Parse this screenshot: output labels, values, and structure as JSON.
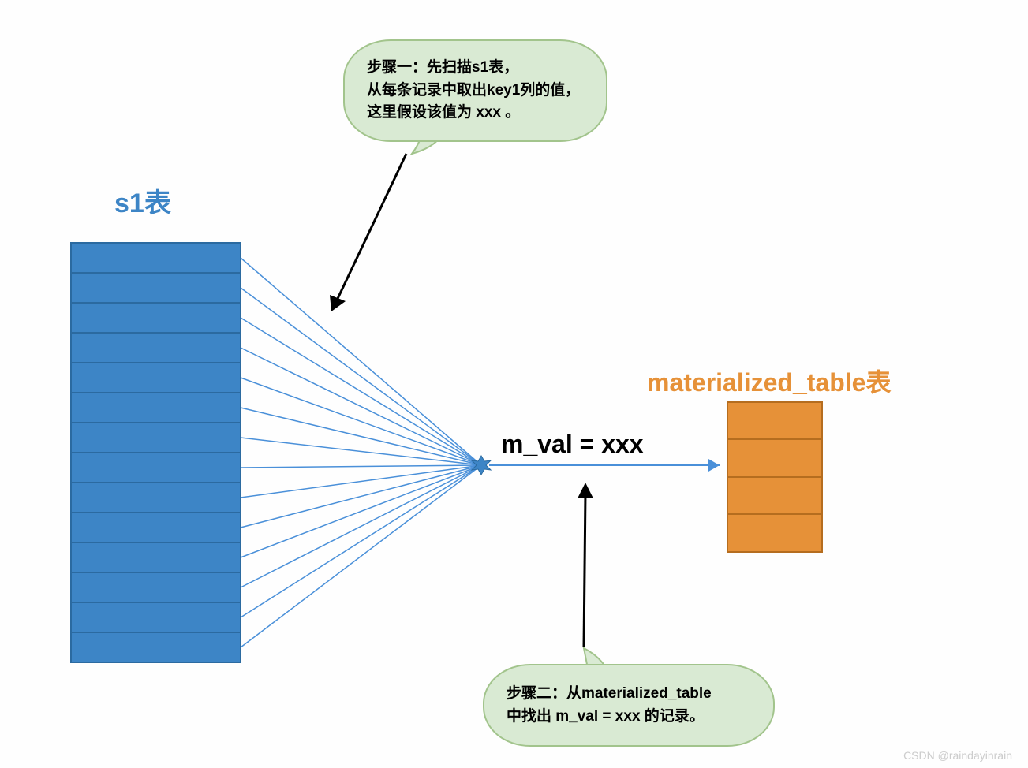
{
  "labels": {
    "s1_table": "s1表",
    "materialized_table": "materialized_table表",
    "m_val": "m_val = xxx"
  },
  "callouts": {
    "step1_line1": "步骤一：先扫描s1表，",
    "step1_line2": "从每条记录中取出key1列的值，",
    "step1_line3": "这里假设该值为 xxx 。",
    "step2_line1": "步骤二：从materialized_table",
    "step2_line2": "中找出 m_val = xxx 的记录。"
  },
  "watermark": "CSDN @raindayinrain",
  "diagram": {
    "s1_rows": 14,
    "mat_rows": 4,
    "colors": {
      "s1_fill": "#3d85c6",
      "s1_border": "#2b6aa0",
      "mat_fill": "#e69138",
      "mat_border": "#b56d1f",
      "line": "#4a90d9",
      "callout_fill": "#d9ead3",
      "callout_border": "#a2c48c"
    }
  }
}
